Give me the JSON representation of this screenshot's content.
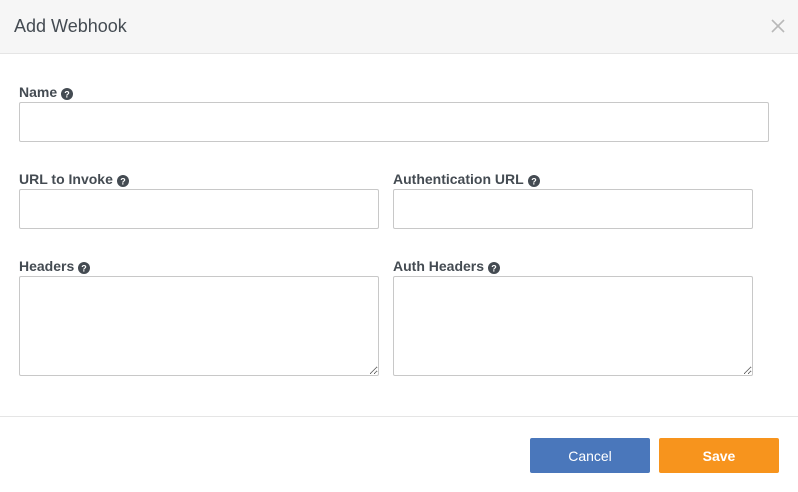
{
  "dialog": {
    "title": "Add Webhook",
    "close_icon": "close-icon"
  },
  "fields": {
    "name": {
      "label": "Name",
      "value": "",
      "placeholder": ""
    },
    "url_to_invoke": {
      "label": "URL to Invoke",
      "value": "",
      "placeholder": ""
    },
    "authentication_url": {
      "label": "Authentication URL",
      "value": "",
      "placeholder": ""
    },
    "headers": {
      "label": "Headers",
      "value": "",
      "placeholder": ""
    },
    "auth_headers": {
      "label": "Auth Headers",
      "value": "",
      "placeholder": ""
    }
  },
  "help_icon": "question-circle-icon",
  "footer": {
    "cancel_label": "Cancel",
    "save_label": "Save"
  },
  "colors": {
    "cancel_button": "#4a77bb",
    "save_button": "#f7941d",
    "header_background": "#f6f6f6",
    "label_text": "#444b52"
  }
}
